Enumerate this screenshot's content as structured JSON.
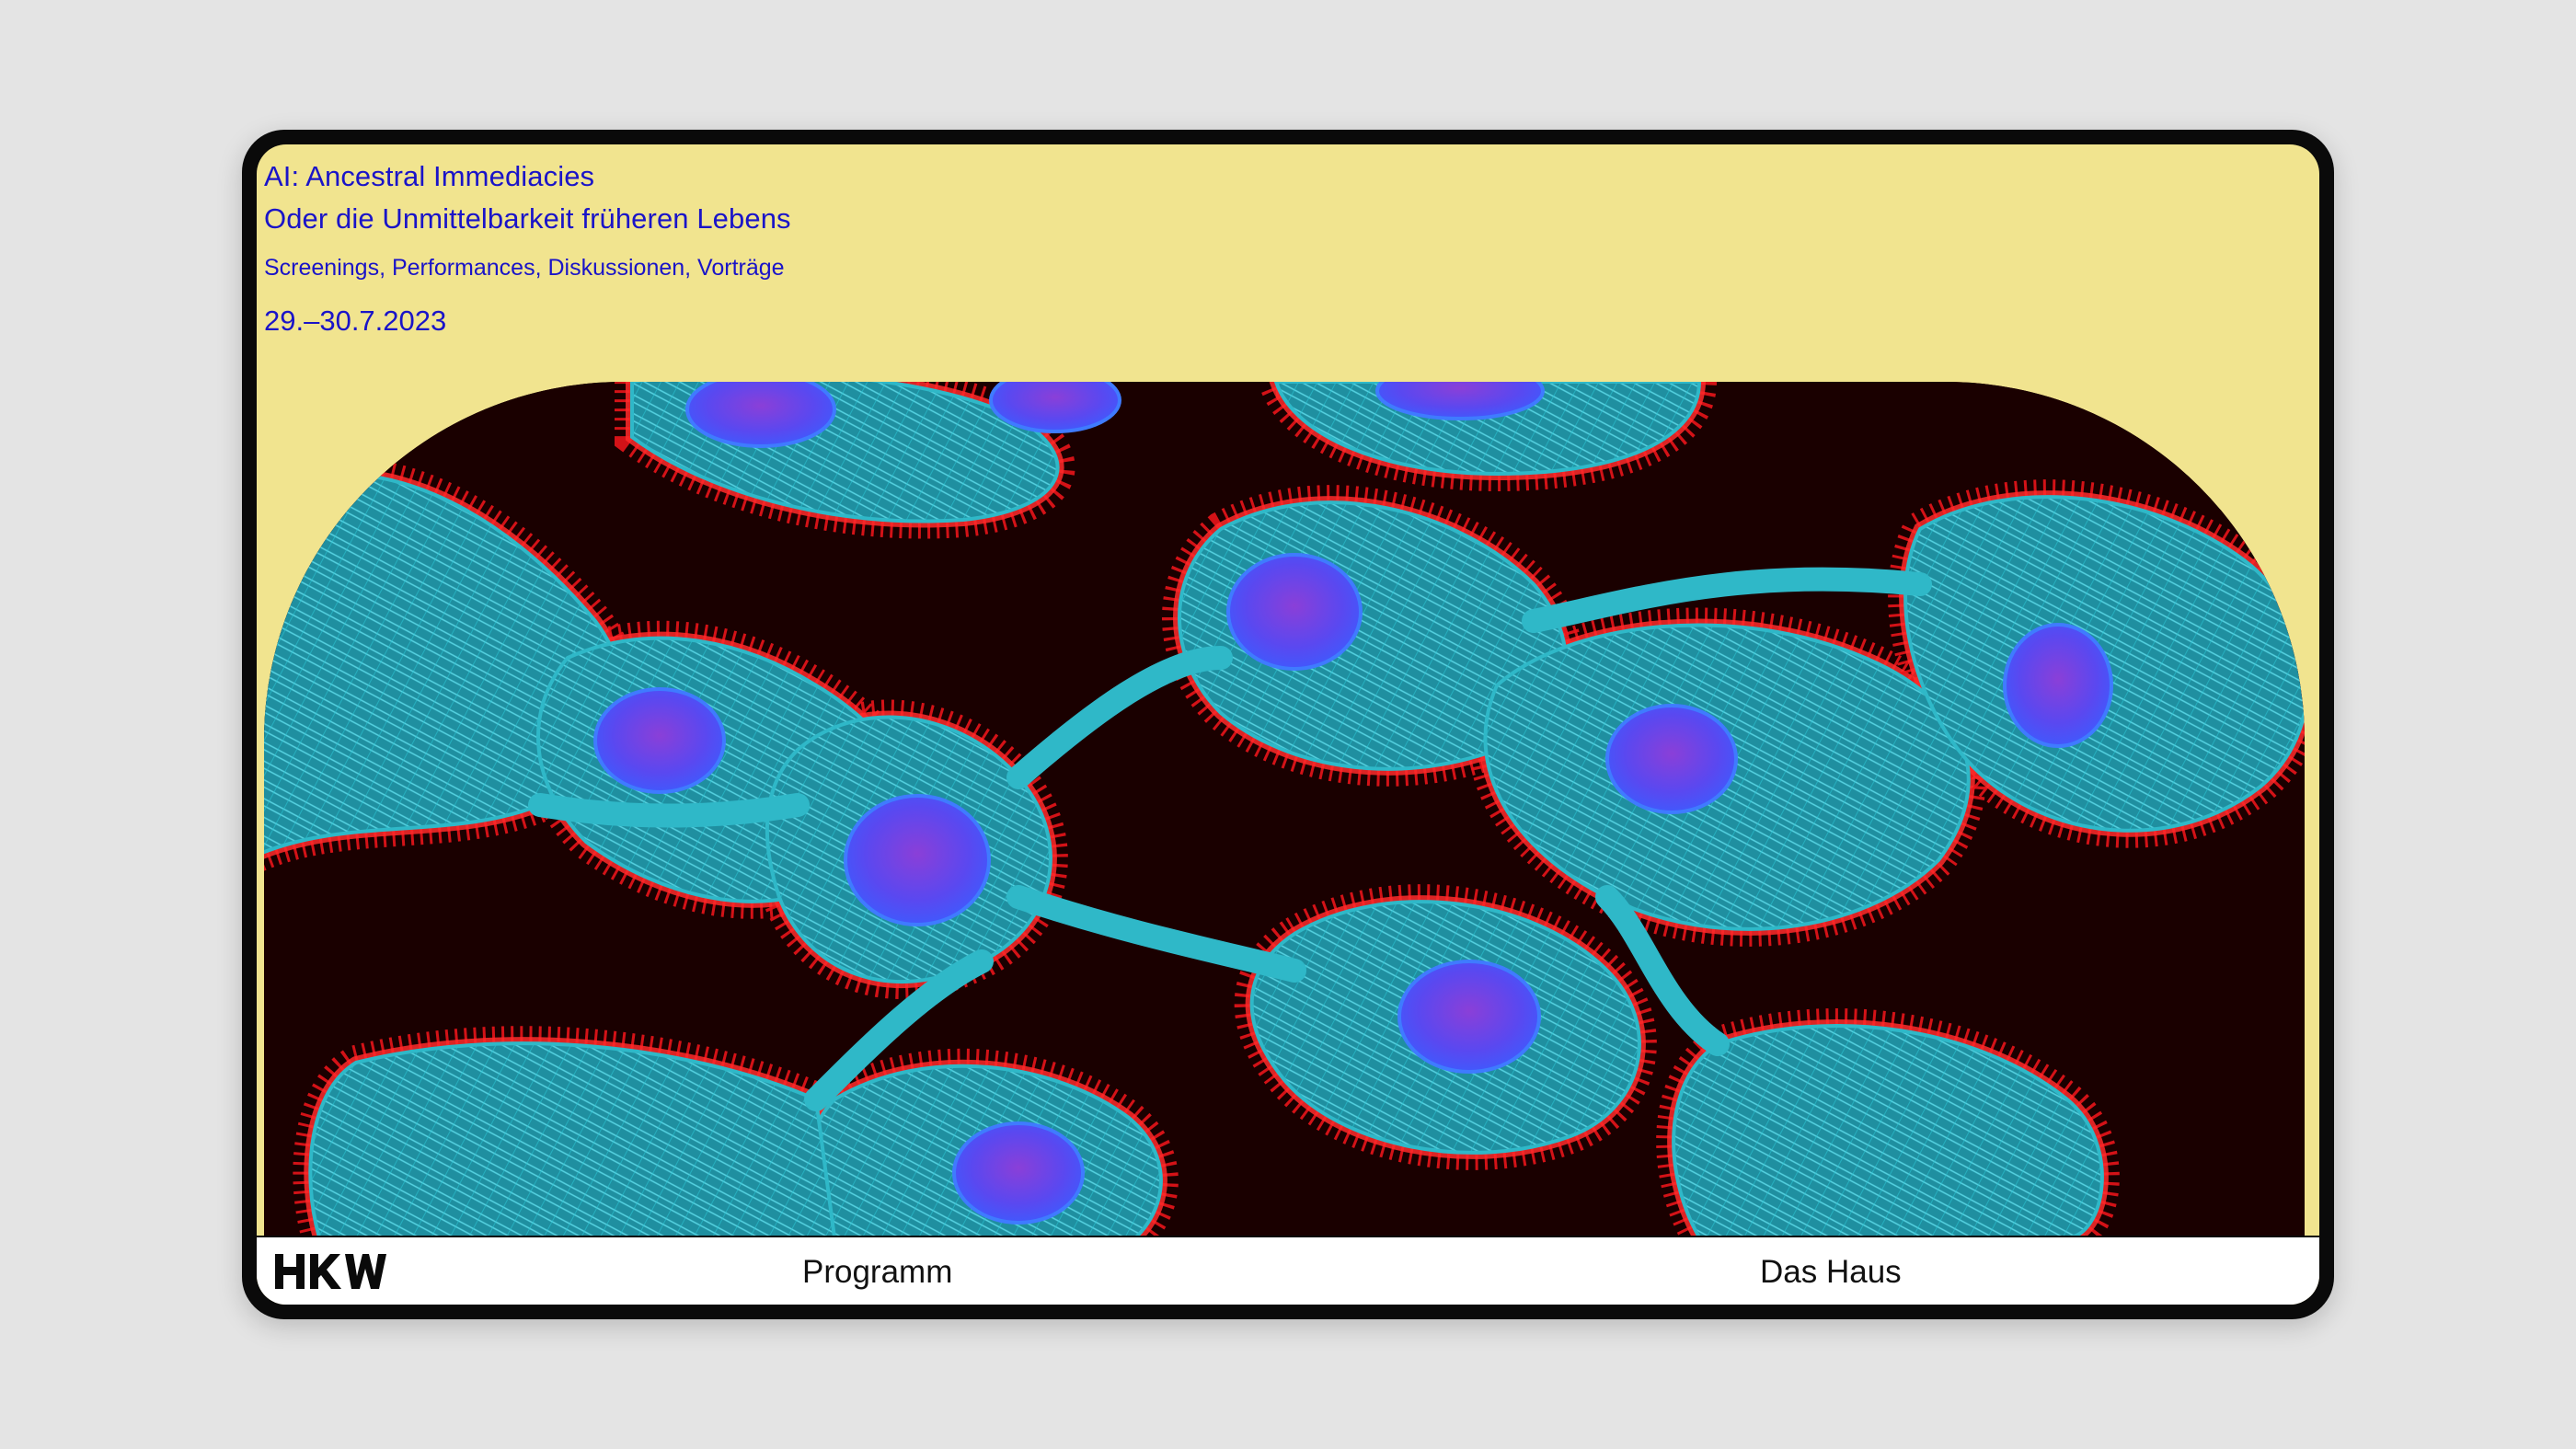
{
  "event": {
    "title_line1": "AI: Ancestral Immediacies",
    "title_line2": "Oder die Unmittelbarkeit früheren Lebens",
    "subtitle": "Screenings, Performances, Diskussionen, Vorträge",
    "dates": "29.–30.7.2023"
  },
  "hero_image": {
    "subject": "fluorescence microscopy of cells",
    "colors": {
      "background": "#1a0000",
      "actin": "#e8141a",
      "microtubules": "#2fb8c8",
      "nuclei": "#6a4cf0"
    }
  },
  "footer": {
    "logo_text": "HKW",
    "nav": [
      {
        "label": "Programm"
      },
      {
        "label": "Das Haus"
      }
    ]
  },
  "theme": {
    "background": "#f1e48f",
    "text_color": "#1a14c8",
    "frame": "#0a0a0a"
  }
}
